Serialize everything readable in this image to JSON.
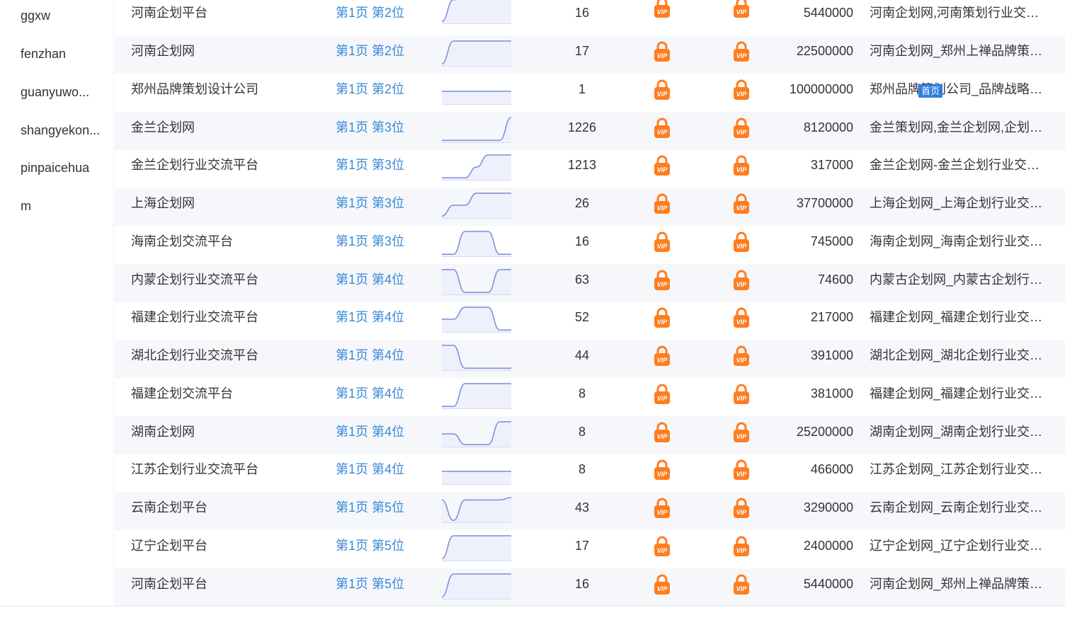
{
  "left_list": [
    "ggxw",
    "fenzhan",
    "guanyuwo...",
    "shangyekon...",
    "pinpaicehua",
    "m"
  ],
  "colors": {
    "link": "#3a89d6",
    "vip_orange": "#ff7d1f",
    "trend_line": "#7b8bdc",
    "trend_fill": "#eef0fb",
    "row_alt": "#f6f7fb",
    "badge": "#2f7de1"
  },
  "home_badge": "首页",
  "rows": [
    {
      "name": "河南企划平台",
      "rank": "第1页 第2位",
      "trend": [
        0.05,
        0.95,
        1,
        1,
        1,
        1,
        1
      ],
      "count": "16",
      "index": "5440000",
      "title": "河南企划网,河南策划行业交流..."
    },
    {
      "name": "河南企划网",
      "rank": "第1页 第2位",
      "trend": [
        0.05,
        1,
        1,
        1,
        1,
        1,
        1
      ],
      "count": "17",
      "index": "22500000",
      "title": "河南企划网_郑州上禅品牌策划..."
    },
    {
      "name": "郑州品牌策划设计公司",
      "rank": "第1页 第2位",
      "trend": [
        0.5,
        0.5,
        0.5,
        0.5,
        0.5,
        0.5,
        0.5
      ],
      "count": "1",
      "index": "100000000",
      "title": "郑州品牌策划公司_品牌战略定..."
    },
    {
      "name": "金兰企划网",
      "rank": "第1页 第3位",
      "trend": [
        0.05,
        0.05,
        0.05,
        0.05,
        0.05,
        0.05,
        1
      ],
      "count": "1226",
      "index": "8120000",
      "title": "金兰策划网,金兰企划网,企划行..."
    },
    {
      "name": "金兰企划行业交流平台",
      "rank": "第1页 第3位",
      "trend": [
        0.05,
        0.05,
        0.05,
        0.5,
        1,
        1,
        1
      ],
      "count": "1213",
      "index": "317000",
      "title": "金兰企划网-金兰企划行业交流..."
    },
    {
      "name": "上海企划网",
      "rank": "第1页 第3位",
      "trend": [
        0.05,
        0.5,
        0.5,
        1,
        1,
        1,
        1
      ],
      "count": "26",
      "index": "37700000",
      "title": "上海企划网_上海企划行业交流..."
    },
    {
      "name": "海南企划交流平台",
      "rank": "第1页 第3位",
      "trend": [
        0.05,
        0.05,
        1,
        1,
        1,
        0.05,
        0.05
      ],
      "count": "16",
      "index": "745000",
      "title": "海南企划网_海南企划行业交流..."
    },
    {
      "name": "内蒙企划行业交流平台",
      "rank": "第1页 第4位",
      "trend": [
        1,
        1,
        0.05,
        0.05,
        0.05,
        1,
        1
      ],
      "count": "63",
      "index": "74600",
      "title": "内蒙古企划网_内蒙古企划行业..."
    },
    {
      "name": "福建企划行业交流平台",
      "rank": "第1页 第4位",
      "trend": [
        0.5,
        0.5,
        1,
        1,
        1,
        0.05,
        0.05
      ],
      "count": "52",
      "index": "217000",
      "title": "福建企划网_福建企划行业交流..."
    },
    {
      "name": "湖北企划行业交流平台",
      "rank": "第1页 第4位",
      "trend": [
        1,
        1,
        0.05,
        0.05,
        0.05,
        0.05,
        0.05
      ],
      "count": "44",
      "index": "391000",
      "title": "湖北企划网_湖北企划行业交流..."
    },
    {
      "name": "福建企划交流平台",
      "rank": "第1页 第4位",
      "trend": [
        0.05,
        0.05,
        1,
        1,
        1,
        1,
        1
      ],
      "count": "8",
      "index": "381000",
      "title": "福建企划网_福建企划行业交流..."
    },
    {
      "name": "湖南企划网",
      "rank": "第1页 第4位",
      "trend": [
        0.5,
        0.5,
        0.05,
        0.05,
        0.05,
        1,
        1
      ],
      "count": "8",
      "index": "25200000",
      "title": "湖南企划网_湖南企划行业交流..."
    },
    {
      "name": "江苏企划行业交流平台",
      "rank": "第1页 第4位",
      "trend": [
        0.5,
        0.5,
        0.5,
        0.5,
        0.5,
        0.5,
        0.5
      ],
      "count": "8",
      "index": "466000",
      "title": "江苏企划网_江苏企划行业交流..."
    },
    {
      "name": "云南企划平台",
      "rank": "第1页 第5位",
      "trend": [
        0.9,
        0.05,
        0.9,
        0.9,
        0.9,
        0.9,
        1
      ],
      "count": "43",
      "index": "3290000",
      "title": "云南企划网_云南企划行业交流..."
    },
    {
      "name": "辽宁企划平台",
      "rank": "第1页 第5位",
      "trend": [
        0.05,
        1,
        1,
        1,
        1,
        1,
        1
      ],
      "count": "17",
      "index": "2400000",
      "title": "辽宁企划网_辽宁企划行业交流..."
    },
    {
      "name": "河南企划平台",
      "rank": "第1页 第5位",
      "trend": [
        0.05,
        1,
        1,
        1,
        1,
        1,
        1
      ],
      "count": "16",
      "index": "5440000",
      "title": "河南企划网_郑州上禅品牌策划..."
    }
  ]
}
